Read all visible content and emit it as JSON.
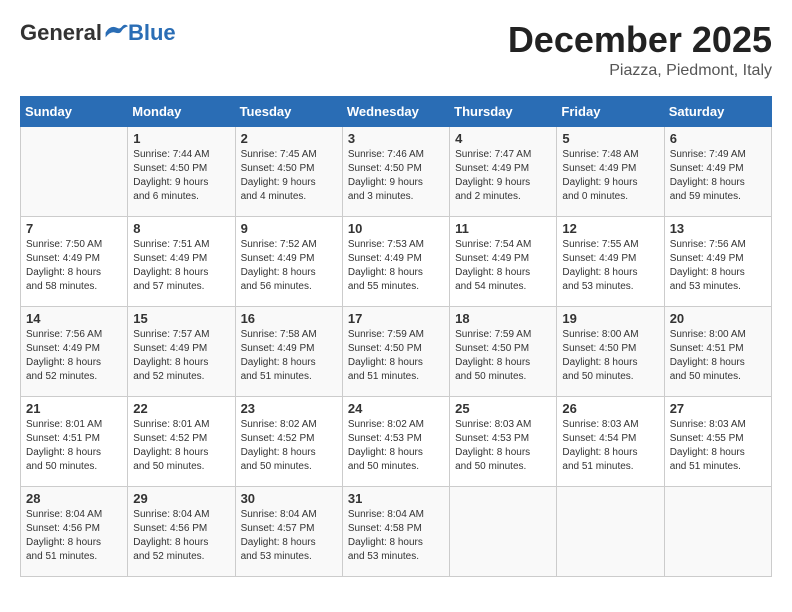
{
  "header": {
    "logo_general": "General",
    "logo_blue": "Blue",
    "month": "December 2025",
    "location": "Piazza, Piedmont, Italy"
  },
  "days_of_week": [
    "Sunday",
    "Monday",
    "Tuesday",
    "Wednesday",
    "Thursday",
    "Friday",
    "Saturday"
  ],
  "weeks": [
    [
      {
        "day": "",
        "content": ""
      },
      {
        "day": "1",
        "content": "Sunrise: 7:44 AM\nSunset: 4:50 PM\nDaylight: 9 hours\nand 6 minutes."
      },
      {
        "day": "2",
        "content": "Sunrise: 7:45 AM\nSunset: 4:50 PM\nDaylight: 9 hours\nand 4 minutes."
      },
      {
        "day": "3",
        "content": "Sunrise: 7:46 AM\nSunset: 4:50 PM\nDaylight: 9 hours\nand 3 minutes."
      },
      {
        "day": "4",
        "content": "Sunrise: 7:47 AM\nSunset: 4:49 PM\nDaylight: 9 hours\nand 2 minutes."
      },
      {
        "day": "5",
        "content": "Sunrise: 7:48 AM\nSunset: 4:49 PM\nDaylight: 9 hours\nand 0 minutes."
      },
      {
        "day": "6",
        "content": "Sunrise: 7:49 AM\nSunset: 4:49 PM\nDaylight: 8 hours\nand 59 minutes."
      }
    ],
    [
      {
        "day": "7",
        "content": "Sunrise: 7:50 AM\nSunset: 4:49 PM\nDaylight: 8 hours\nand 58 minutes."
      },
      {
        "day": "8",
        "content": "Sunrise: 7:51 AM\nSunset: 4:49 PM\nDaylight: 8 hours\nand 57 minutes."
      },
      {
        "day": "9",
        "content": "Sunrise: 7:52 AM\nSunset: 4:49 PM\nDaylight: 8 hours\nand 56 minutes."
      },
      {
        "day": "10",
        "content": "Sunrise: 7:53 AM\nSunset: 4:49 PM\nDaylight: 8 hours\nand 55 minutes."
      },
      {
        "day": "11",
        "content": "Sunrise: 7:54 AM\nSunset: 4:49 PM\nDaylight: 8 hours\nand 54 minutes."
      },
      {
        "day": "12",
        "content": "Sunrise: 7:55 AM\nSunset: 4:49 PM\nDaylight: 8 hours\nand 53 minutes."
      },
      {
        "day": "13",
        "content": "Sunrise: 7:56 AM\nSunset: 4:49 PM\nDaylight: 8 hours\nand 53 minutes."
      }
    ],
    [
      {
        "day": "14",
        "content": "Sunrise: 7:56 AM\nSunset: 4:49 PM\nDaylight: 8 hours\nand 52 minutes."
      },
      {
        "day": "15",
        "content": "Sunrise: 7:57 AM\nSunset: 4:49 PM\nDaylight: 8 hours\nand 52 minutes."
      },
      {
        "day": "16",
        "content": "Sunrise: 7:58 AM\nSunset: 4:49 PM\nDaylight: 8 hours\nand 51 minutes."
      },
      {
        "day": "17",
        "content": "Sunrise: 7:59 AM\nSunset: 4:50 PM\nDaylight: 8 hours\nand 51 minutes."
      },
      {
        "day": "18",
        "content": "Sunrise: 7:59 AM\nSunset: 4:50 PM\nDaylight: 8 hours\nand 50 minutes."
      },
      {
        "day": "19",
        "content": "Sunrise: 8:00 AM\nSunset: 4:50 PM\nDaylight: 8 hours\nand 50 minutes."
      },
      {
        "day": "20",
        "content": "Sunrise: 8:00 AM\nSunset: 4:51 PM\nDaylight: 8 hours\nand 50 minutes."
      }
    ],
    [
      {
        "day": "21",
        "content": "Sunrise: 8:01 AM\nSunset: 4:51 PM\nDaylight: 8 hours\nand 50 minutes."
      },
      {
        "day": "22",
        "content": "Sunrise: 8:01 AM\nSunset: 4:52 PM\nDaylight: 8 hours\nand 50 minutes."
      },
      {
        "day": "23",
        "content": "Sunrise: 8:02 AM\nSunset: 4:52 PM\nDaylight: 8 hours\nand 50 minutes."
      },
      {
        "day": "24",
        "content": "Sunrise: 8:02 AM\nSunset: 4:53 PM\nDaylight: 8 hours\nand 50 minutes."
      },
      {
        "day": "25",
        "content": "Sunrise: 8:03 AM\nSunset: 4:53 PM\nDaylight: 8 hours\nand 50 minutes."
      },
      {
        "day": "26",
        "content": "Sunrise: 8:03 AM\nSunset: 4:54 PM\nDaylight: 8 hours\nand 51 minutes."
      },
      {
        "day": "27",
        "content": "Sunrise: 8:03 AM\nSunset: 4:55 PM\nDaylight: 8 hours\nand 51 minutes."
      }
    ],
    [
      {
        "day": "28",
        "content": "Sunrise: 8:04 AM\nSunset: 4:56 PM\nDaylight: 8 hours\nand 51 minutes."
      },
      {
        "day": "29",
        "content": "Sunrise: 8:04 AM\nSunset: 4:56 PM\nDaylight: 8 hours\nand 52 minutes."
      },
      {
        "day": "30",
        "content": "Sunrise: 8:04 AM\nSunset: 4:57 PM\nDaylight: 8 hours\nand 53 minutes."
      },
      {
        "day": "31",
        "content": "Sunrise: 8:04 AM\nSunset: 4:58 PM\nDaylight: 8 hours\nand 53 minutes."
      },
      {
        "day": "",
        "content": ""
      },
      {
        "day": "",
        "content": ""
      },
      {
        "day": "",
        "content": ""
      }
    ]
  ]
}
